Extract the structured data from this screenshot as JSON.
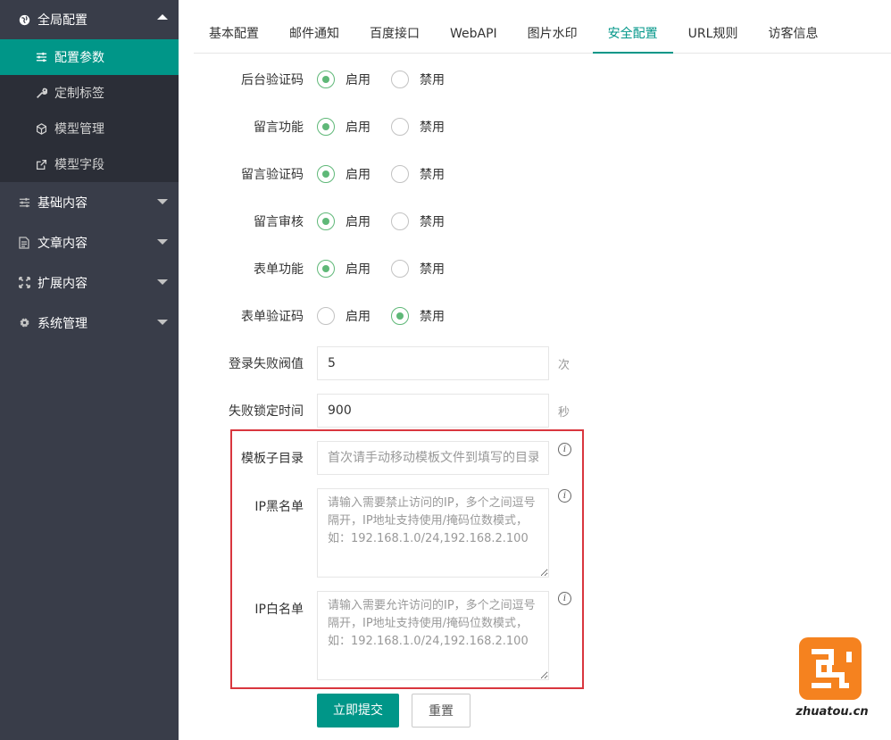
{
  "sidebar": {
    "groups": [
      {
        "label": "全局配置",
        "icon": "globe-icon",
        "expanded": true
      },
      {
        "label": "基础内容",
        "icon": "sliders-icon",
        "expanded": false
      },
      {
        "label": "文章内容",
        "icon": "document-icon",
        "expanded": false
      },
      {
        "label": "扩展内容",
        "icon": "expand-icon",
        "expanded": false
      },
      {
        "label": "系统管理",
        "icon": "gear-icon",
        "expanded": false
      }
    ],
    "sub_items": [
      {
        "label": "配置参数",
        "icon": "sliders-icon",
        "active": true
      },
      {
        "label": "定制标签",
        "icon": "wrench-icon",
        "active": false
      },
      {
        "label": "模型管理",
        "icon": "cube-icon",
        "active": false
      },
      {
        "label": "模型字段",
        "icon": "external-link-icon",
        "active": false
      }
    ]
  },
  "tabs": [
    {
      "label": "基本配置",
      "active": false
    },
    {
      "label": "邮件通知",
      "active": false
    },
    {
      "label": "百度接口",
      "active": false
    },
    {
      "label": "WebAPI",
      "active": false
    },
    {
      "label": "图片水印",
      "active": false
    },
    {
      "label": "安全配置",
      "active": true
    },
    {
      "label": "URL规则",
      "active": false
    },
    {
      "label": "访客信息",
      "active": false
    }
  ],
  "radio_options": {
    "on": "启用",
    "off": "禁用"
  },
  "radio_rows": [
    {
      "label": "后台验证码",
      "value": "on"
    },
    {
      "label": "留言功能",
      "value": "on"
    },
    {
      "label": "留言验证码",
      "value": "on"
    },
    {
      "label": "留言审核",
      "value": "on"
    },
    {
      "label": "表单功能",
      "value": "on"
    },
    {
      "label": "表单验证码",
      "value": "off"
    }
  ],
  "login_fail_threshold": {
    "label": "登录失败阀值",
    "value": "5",
    "unit": "次"
  },
  "fail_lock_time": {
    "label": "失败锁定时间",
    "value": "900",
    "unit": "秒"
  },
  "template_subdir": {
    "label": "模板子目录",
    "placeholder": "首次请手动移动模板文件到填写的目录!"
  },
  "ip_blacklist": {
    "label": "IP黑名单",
    "placeholder": "请输入需要禁止访问的IP，多个之间逗号隔开，IP地址支持使用/掩码位数模式，如：192.168.1.0/24,192.168.2.100"
  },
  "ip_whitelist": {
    "label": "IP白名单",
    "placeholder": "请输入需要允许访问的IP，多个之间逗号隔开，IP地址支持使用/掩码位数模式，如：192.168.1.0/24,192.168.2.100"
  },
  "buttons": {
    "submit": "立即提交",
    "reset": "重置"
  },
  "watermark": {
    "text": "zhuatou.cn"
  },
  "colors": {
    "sidebar_bg": "#393D49",
    "accent": "#009688",
    "radio_checked": "#5FB878",
    "highlight": "#d9363e",
    "watermark": "#f5821f"
  }
}
